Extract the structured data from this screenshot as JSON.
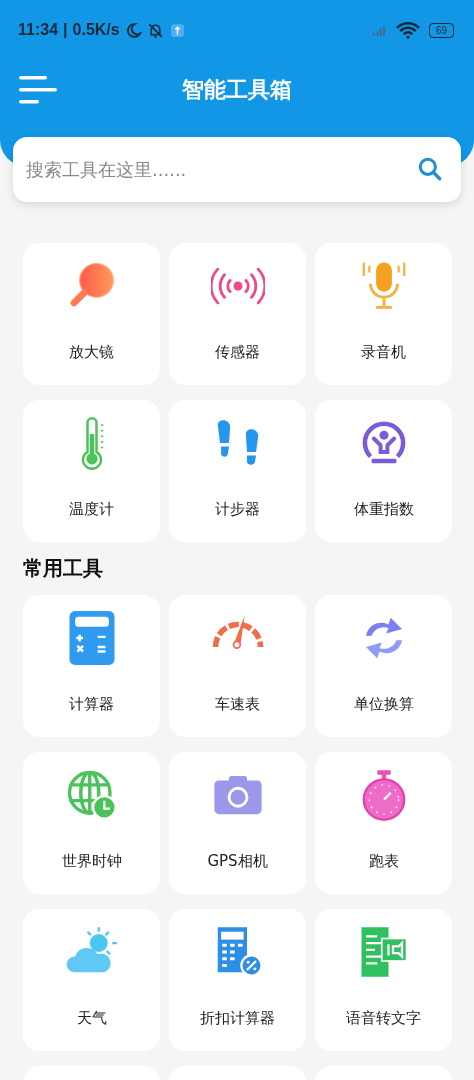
{
  "status_bar": {
    "time": "11:34",
    "separator": "|",
    "speed": "0.5K/s",
    "battery": "69"
  },
  "header": {
    "title": "智能工具箱"
  },
  "search": {
    "placeholder": "搜索工具在这里......"
  },
  "sections": [
    {
      "tools": [
        {
          "label": "放大镜"
        },
        {
          "label": "传感器"
        },
        {
          "label": "录音机"
        },
        {
          "label": "温度计"
        },
        {
          "label": "计步器"
        },
        {
          "label": "体重指数"
        }
      ]
    },
    {
      "title": "常用工具",
      "tools": [
        {
          "label": "计算器"
        },
        {
          "label": "车速表"
        },
        {
          "label": "单位换算"
        },
        {
          "label": "世界时钟"
        },
        {
          "label": "GPS相机"
        },
        {
          "label": "跑表"
        },
        {
          "label": "天气"
        },
        {
          "label": "折扣计算器"
        },
        {
          "label": "语音转文字"
        }
      ]
    }
  ]
}
